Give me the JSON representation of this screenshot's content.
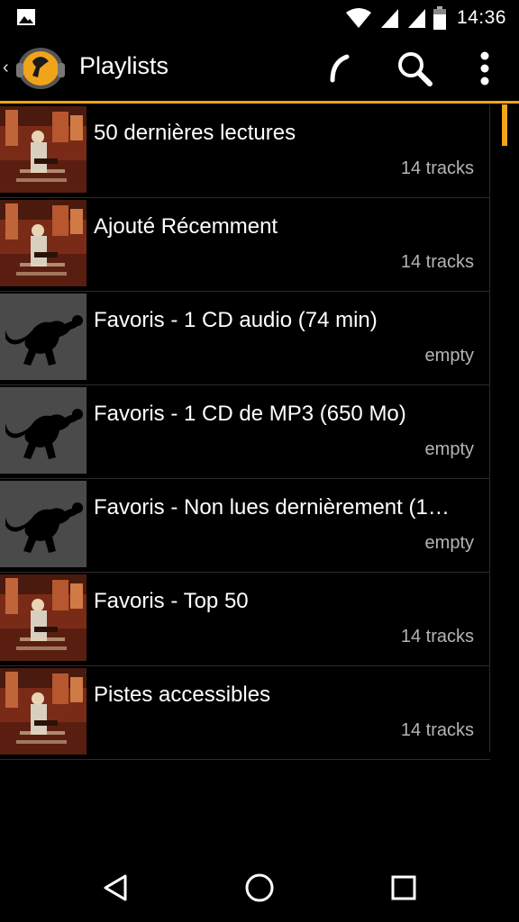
{
  "status_bar": {
    "time": "14:36",
    "icons": [
      "gallery-icon",
      "wifi-icon",
      "signal-icon",
      "signal-icon",
      "battery-icon"
    ]
  },
  "action_bar": {
    "title": "Playlists",
    "back_glyph": "‹",
    "actions": [
      "refresh-icon",
      "search-icon",
      "more-icon"
    ],
    "accent_color": "#f0a41a"
  },
  "playlists": [
    {
      "title": "50 dernières lectures",
      "count": "14 tracks",
      "art": "album-art"
    },
    {
      "title": "Ajouté Récemment",
      "count": "14 tracks",
      "art": "album-art"
    },
    {
      "title": "Favoris - 1 CD audio (74 min)",
      "count": "empty",
      "art": "monkey-art"
    },
    {
      "title": "Favoris - 1 CD de MP3 (650 Mo)",
      "count": "empty",
      "art": "monkey-art"
    },
    {
      "title": "Favoris - Non lues dernièrement (1…",
      "count": "empty",
      "art": "monkey-art"
    },
    {
      "title": "Favoris - Top 50",
      "count": "14 tracks",
      "art": "album-art"
    },
    {
      "title": "Pistes accessibles",
      "count": "14 tracks",
      "art": "album-art"
    }
  ],
  "nav_bar": [
    "back-icon",
    "home-icon",
    "recents-icon"
  ]
}
